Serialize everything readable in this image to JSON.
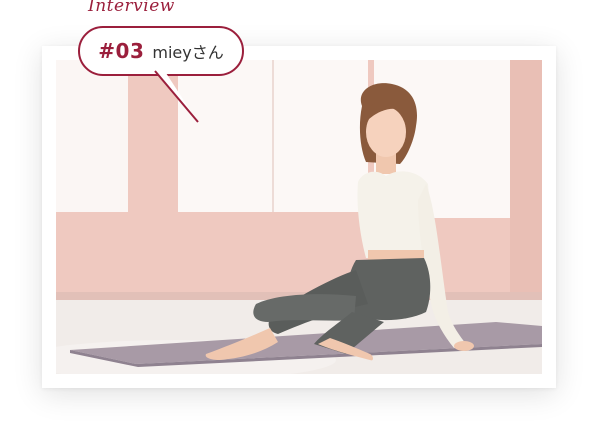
{
  "interview": {
    "heading": "Interview",
    "number": "#03",
    "name": "mieyさん"
  },
  "photo": {
    "alt": "mieyさん"
  },
  "colors": {
    "accent": "#9b1f3c",
    "wall": "#efc9c0",
    "window": "#fbf6f4",
    "floor": "#f1ece9",
    "mat": "#a89aa6",
    "leggings": "#5f6260",
    "top": "#f5f2ea"
  }
}
